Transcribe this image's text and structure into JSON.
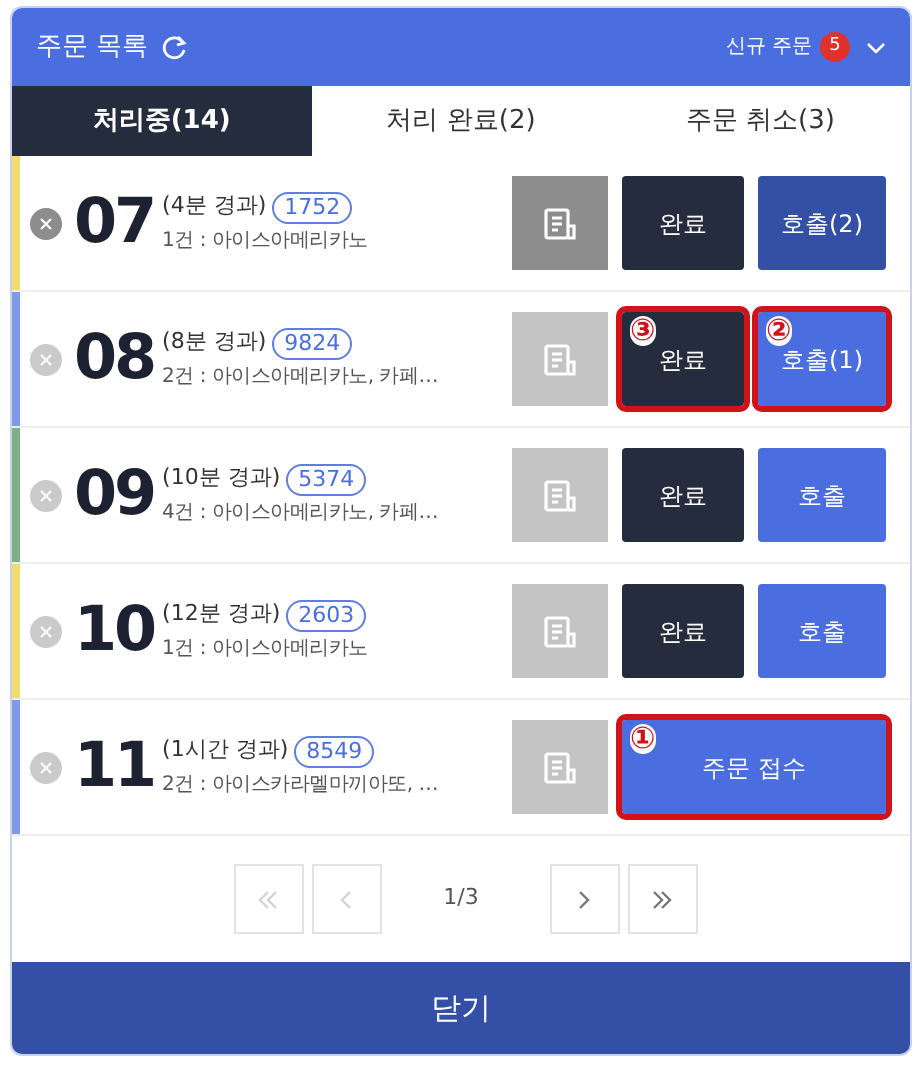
{
  "header": {
    "title": "주문 목록",
    "new_orders_label": "신규 주문",
    "new_orders_count": "5"
  },
  "tabs": [
    {
      "label": "처리중(14)",
      "selected": true
    },
    {
      "label": "처리 완료(2)",
      "selected": false
    },
    {
      "label": "주문 취소(3)",
      "selected": false
    }
  ],
  "orders": [
    {
      "number": "07",
      "elapsed": "(4분 경과)",
      "code": "1752",
      "items": "1건 : 아이스아메리카노",
      "color": "#f2dc6b",
      "receipt_enabled": true,
      "actions": [
        {
          "kind": "complete",
          "label": "완료"
        },
        {
          "kind": "call",
          "label": "호출(2)",
          "called": true
        }
      ]
    },
    {
      "number": "08",
      "elapsed": "(8분 경과)",
      "code": "9824",
      "items": "2건 : 아이스아메리카노, 카페…",
      "color": "#7f9be8",
      "receipt_enabled": false,
      "actions": [
        {
          "kind": "complete",
          "label": "완료",
          "callout": "③"
        },
        {
          "kind": "call",
          "label": "호출(1)",
          "called": false,
          "callout": "②"
        }
      ]
    },
    {
      "number": "09",
      "elapsed": "(10분 경과)",
      "code": "5374",
      "items": "4건 : 아이스아메리카노, 카페…",
      "color": "#7fae8a",
      "receipt_enabled": false,
      "actions": [
        {
          "kind": "complete",
          "label": "완료"
        },
        {
          "kind": "call",
          "label": "호출",
          "called": false
        }
      ]
    },
    {
      "number": "10",
      "elapsed": "(12분 경과)",
      "code": "2603",
      "items": "1건 : 아이스아메리카노",
      "color": "#f2dc6b",
      "receipt_enabled": false,
      "actions": [
        {
          "kind": "complete",
          "label": "완료"
        },
        {
          "kind": "call",
          "label": "호출",
          "called": false
        }
      ]
    },
    {
      "number": "11",
      "elapsed": "(1시간 경과)",
      "code": "8549",
      "items": "2건 : 아이스카라멜마끼아또, …",
      "color": "#7f9be8",
      "receipt_enabled": false,
      "actions": [
        {
          "kind": "accept",
          "label": "주문 접수",
          "callout": "①"
        }
      ]
    }
  ],
  "pagination": {
    "page": "1/3",
    "first_disabled": true,
    "prev_disabled": true,
    "next_disabled": false,
    "last_disabled": false
  },
  "close_button": "닫기"
}
